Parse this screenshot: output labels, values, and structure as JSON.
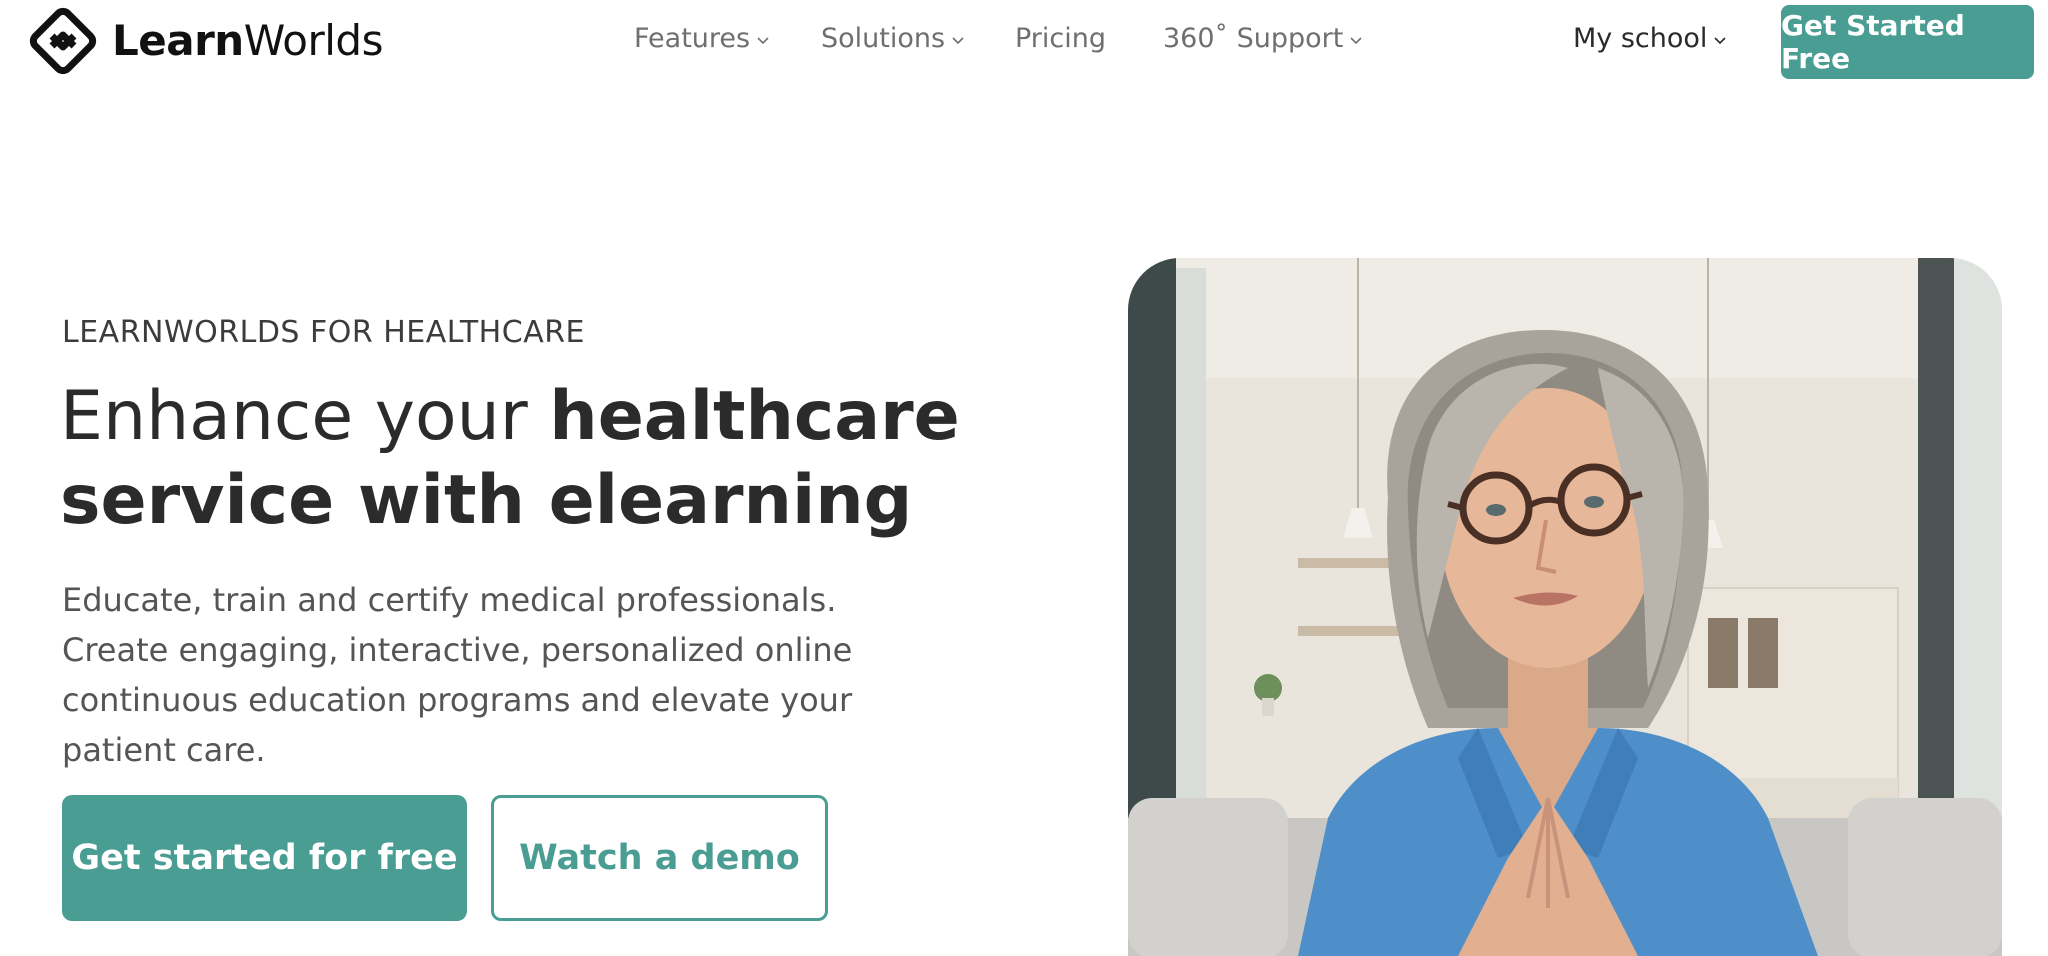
{
  "brand": {
    "name_bold": "Learn",
    "name_regular": "Worlds",
    "accent_color": "#4a9d93"
  },
  "nav": {
    "items": [
      {
        "label": "Features",
        "has_dropdown": true
      },
      {
        "label": "Solutions",
        "has_dropdown": true
      },
      {
        "label": "Pricing",
        "has_dropdown": false
      },
      {
        "label": "360˚ Support",
        "has_dropdown": true
      }
    ],
    "my_school": "My school",
    "cta": "Get Started Free"
  },
  "hero": {
    "eyebrow": "LEARNWORLDS FOR HEALTHCARE",
    "headline_light": "Enhance your ",
    "headline_bold_1": "healthcare",
    "headline_bold_2": "service with elearning",
    "lead": "Educate, train and certify medical professionals. Create engaging, interactive, personalized online continuous education programs and elevate your patient care.",
    "primary_button": "Get started for free",
    "secondary_button": "Watch a demo"
  },
  "icons": {
    "logo": "learnworlds-diamond-logo-icon",
    "dropdown": "chevron-down-icon"
  }
}
